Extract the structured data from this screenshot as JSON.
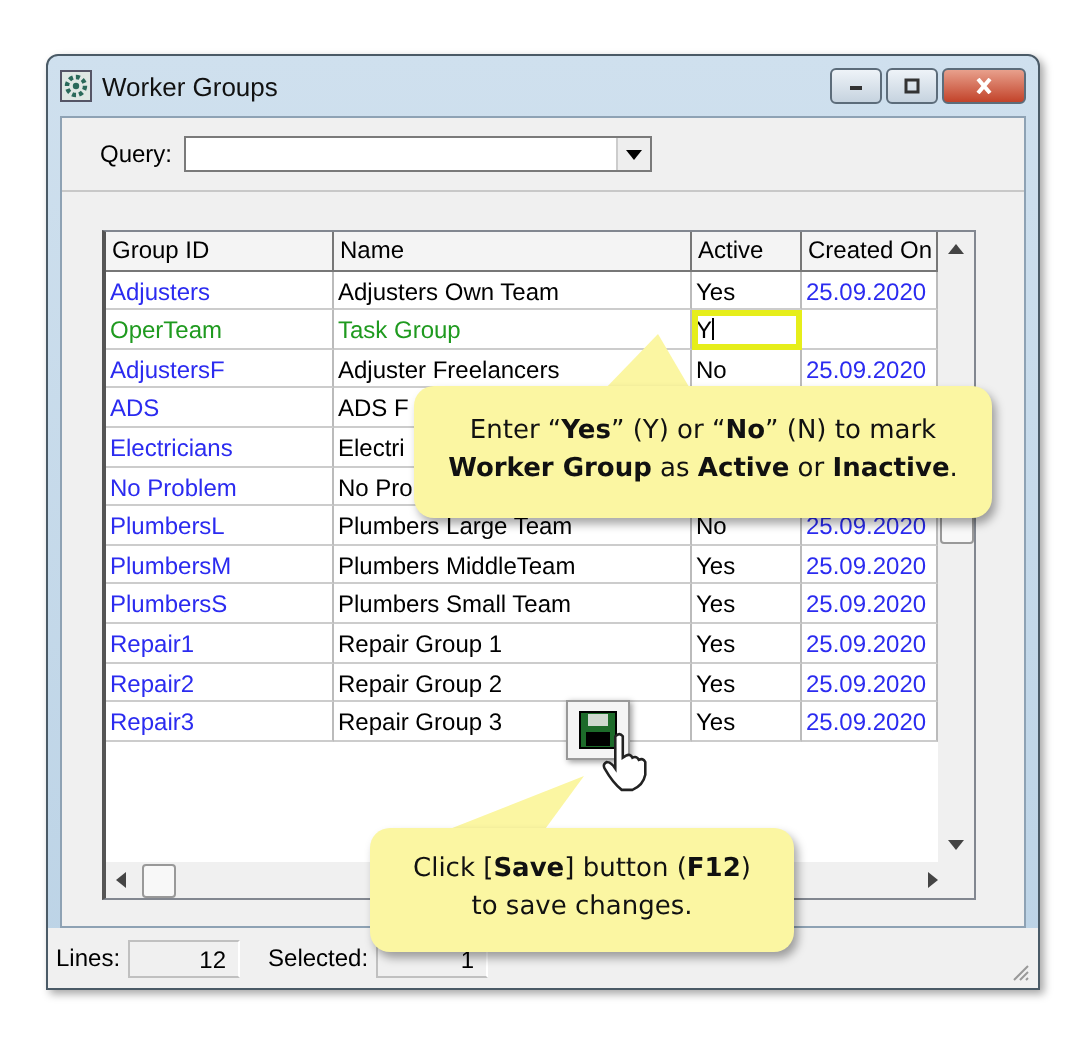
{
  "window": {
    "title": "Worker Groups"
  },
  "query": {
    "label": "Query:"
  },
  "table": {
    "columns": [
      "Group ID",
      "Name",
      "Active",
      "Created On"
    ],
    "rows": [
      {
        "group_id": "Adjusters",
        "name": "Adjusters Own Team",
        "active": "Yes",
        "created_on": "25.09.2020",
        "edited": false,
        "editing": false
      },
      {
        "group_id": "OperTeam",
        "name": "Task Group",
        "active": "Y",
        "edited": true,
        "editing": true
      },
      {
        "group_id": "AdjustersF",
        "name": "Adjuster Freelancers",
        "active": "No",
        "created_on": "25.09.2020",
        "edited": false,
        "editing": false
      },
      {
        "group_id": "ADS",
        "name": "ADS F",
        "edited": false
      },
      {
        "group_id": "Electricians",
        "name": "Electri",
        "edited": false
      },
      {
        "group_id": "No Problem",
        "name": "No Pro",
        "edited": false
      },
      {
        "group_id": "PlumbersL",
        "name": "Plumbers Large Team",
        "active": "No",
        "created_on": "25.09.2020",
        "edited": false,
        "editing": false
      },
      {
        "group_id": "PlumbersM",
        "name": "Plumbers MiddleTeam",
        "active": "Yes",
        "created_on": "25.09.2020",
        "edited": false,
        "editing": false
      },
      {
        "group_id": "PlumbersS",
        "name": "Plumbers Small Team",
        "active": "Yes",
        "created_on": "25.09.2020",
        "edited": false,
        "editing": false
      },
      {
        "group_id": "Repair1",
        "name": "Repair Group 1",
        "active": "Yes",
        "created_on": "25.09.2020",
        "edited": false,
        "editing": false
      },
      {
        "group_id": "Repair2",
        "name": "Repair Group 2",
        "active": "Yes",
        "created_on": "25.09.2020",
        "edited": false,
        "editing": false
      },
      {
        "group_id": "Repair3",
        "name": "Repair Group 3",
        "active": "Yes",
        "created_on": "25.09.2020",
        "edited": false,
        "editing": false
      }
    ]
  },
  "status_bar": {
    "lines_label": "Lines:",
    "lines": "12",
    "selected_label": "Selected:",
    "selected": "1"
  },
  "callouts": [
    {
      "kind": "active-hint",
      "text": "Enter “**Yes**” (Y) or “**No**” (N) to mark **Worker Group** as **Active** or **Inactive**."
    },
    {
      "kind": "save-hint",
      "text": "Click [**Save**] button (**F12**) to save changes."
    }
  ]
}
